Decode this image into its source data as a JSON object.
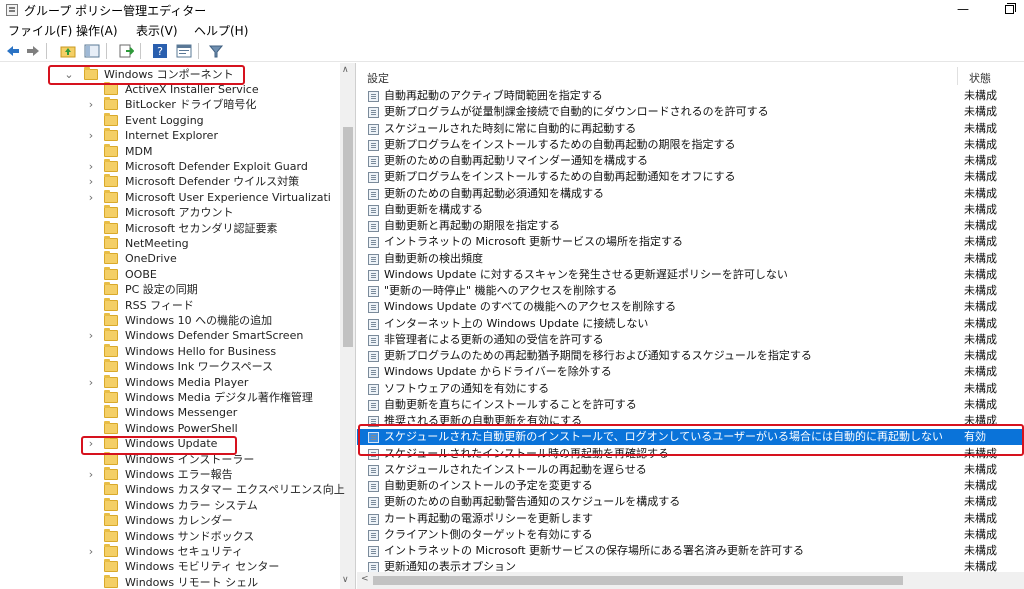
{
  "window": {
    "title": "グループ ポリシー管理エディター",
    "minimize_glyph": "—",
    "restore_glyph": ""
  },
  "menu": [
    "ファイル(F)",
    "操作(A)",
    "表示(V)",
    "ヘルプ(H)"
  ],
  "toolbar_icons": [
    "back-arrow-icon",
    "forward-arrow-icon",
    "up-folder-icon",
    "show-hide-tree-icon",
    "export-list-icon",
    "help-icon",
    "properties-icon",
    "filter-icon"
  ],
  "tree": {
    "parent": {
      "label": "Windows コンポーネント",
      "expanded": true
    },
    "items": [
      {
        "label": "ActiveX Installer Service",
        "has_children": false
      },
      {
        "label": "BitLocker ドライブ暗号化",
        "has_children": true
      },
      {
        "label": "Event Logging",
        "has_children": false
      },
      {
        "label": "Internet Explorer",
        "has_children": true
      },
      {
        "label": "MDM",
        "has_children": false
      },
      {
        "label": "Microsoft Defender Exploit Guard",
        "has_children": true
      },
      {
        "label": "Microsoft Defender ウイルス対策",
        "has_children": true
      },
      {
        "label": "Microsoft User Experience Virtualizati",
        "has_children": true
      },
      {
        "label": "Microsoft アカウント",
        "has_children": false
      },
      {
        "label": "Microsoft セカンダリ認証要素",
        "has_children": false
      },
      {
        "label": "NetMeeting",
        "has_children": false
      },
      {
        "label": "OneDrive",
        "has_children": false
      },
      {
        "label": "OOBE",
        "has_children": false
      },
      {
        "label": "PC 設定の同期",
        "has_children": false
      },
      {
        "label": "RSS フィード",
        "has_children": false
      },
      {
        "label": "Windows 10 への機能の追加",
        "has_children": false
      },
      {
        "label": "Windows Defender SmartScreen",
        "has_children": true
      },
      {
        "label": "Windows Hello for Business",
        "has_children": false
      },
      {
        "label": "Windows Ink ワークスペース",
        "has_children": false
      },
      {
        "label": "Windows Media Player",
        "has_children": true
      },
      {
        "label": "Windows Media デジタル著作権管理",
        "has_children": false
      },
      {
        "label": "Windows Messenger",
        "has_children": false
      },
      {
        "label": "Windows PowerShell",
        "has_children": false
      },
      {
        "label": "Windows Update",
        "has_children": true,
        "selected": true
      },
      {
        "label": "Windows インストーラー",
        "has_children": false
      },
      {
        "label": "Windows エラー報告",
        "has_children": true
      },
      {
        "label": "Windows カスタマー エクスペリエンス向上",
        "has_children": false
      },
      {
        "label": "Windows カラー システム",
        "has_children": false
      },
      {
        "label": "Windows カレンダー",
        "has_children": false
      },
      {
        "label": "Windows サンドボックス",
        "has_children": false
      },
      {
        "label": "Windows セキュリティ",
        "has_children": true
      },
      {
        "label": "Windows モビリティ センター",
        "has_children": false
      },
      {
        "label": "Windows リモート シェル",
        "has_children": false
      }
    ]
  },
  "list": {
    "columns": {
      "setting": "設定",
      "state": "状態"
    },
    "rows": [
      {
        "name": "自動再起動のアクティブ時間範囲を指定する",
        "state": "未構成"
      },
      {
        "name": "更新プログラムが従量制課金接続で自動的にダウンロードされるのを許可する",
        "state": "未構成"
      },
      {
        "name": "スケジュールされた時刻に常に自動的に再起動する",
        "state": "未構成"
      },
      {
        "name": "更新プログラムをインストールするための自動再起動の期限を指定する",
        "state": "未構成"
      },
      {
        "name": "更新のための自動再起動リマインダー通知を構成する",
        "state": "未構成"
      },
      {
        "name": "更新プログラムをインストールするための自動再起動通知をオフにする",
        "state": "未構成"
      },
      {
        "name": "更新のための自動再起動必須通知を構成する",
        "state": "未構成"
      },
      {
        "name": "自動更新を構成する",
        "state": "未構成"
      },
      {
        "name": "自動更新と再起動の期限を指定する",
        "state": "未構成"
      },
      {
        "name": "イントラネットの Microsoft 更新サービスの場所を指定する",
        "state": "未構成"
      },
      {
        "name": "自動更新の検出頻度",
        "state": "未構成"
      },
      {
        "name": "Windows Update に対するスキャンを発生させる更新遅延ポリシーを許可しない",
        "state": "未構成"
      },
      {
        "name": "\"更新の一時停止\" 機能へのアクセスを削除する",
        "state": "未構成"
      },
      {
        "name": "Windows Update のすべての機能へのアクセスを削除する",
        "state": "未構成"
      },
      {
        "name": "インターネット上の Windows Update に接続しない",
        "state": "未構成"
      },
      {
        "name": "非管理者による更新の通知の受信を許可する",
        "state": "未構成"
      },
      {
        "name": "更新プログラムのための再起動猶予期間を移行および通知するスケジュールを指定する",
        "state": "未構成"
      },
      {
        "name": "Windows Update からドライバーを除外する",
        "state": "未構成"
      },
      {
        "name": "ソフトウェアの通知を有効にする",
        "state": "未構成"
      },
      {
        "name": "自動更新を直ちにインストールすることを許可する",
        "state": "未構成"
      },
      {
        "name": "推奨される更新の自動更新を有効にする",
        "state": "未構成"
      },
      {
        "name": "スケジュールされた自動更新のインストールで、ログオンしているユーザーがいる場合には自動的に再起動しない",
        "state": "有効",
        "selected": true
      },
      {
        "name": "スケジュールされたインストール時の再起動を再確認する",
        "state": "未構成"
      },
      {
        "name": "スケジュールされたインストールの再起動を遅らせる",
        "state": "未構成"
      },
      {
        "name": "自動更新のインストールの予定を変更する",
        "state": "未構成"
      },
      {
        "name": "更新のための自動再起動警告通知のスケジュールを構成する",
        "state": "未構成"
      },
      {
        "name": "カート再起動の電源ポリシーを更新します",
        "state": "未構成"
      },
      {
        "name": "クライアント側のターゲットを有効にする",
        "state": "未構成"
      },
      {
        "name": "イントラネットの Microsoft 更新サービスの保存場所にある署名済み更新を許可する",
        "state": "未構成"
      },
      {
        "name": "更新通知の表示オプション",
        "state": "未構成"
      }
    ]
  },
  "colors": {
    "selection": "#0a73d9",
    "annotation": "#d6121e",
    "folder": "#f4cf66"
  }
}
